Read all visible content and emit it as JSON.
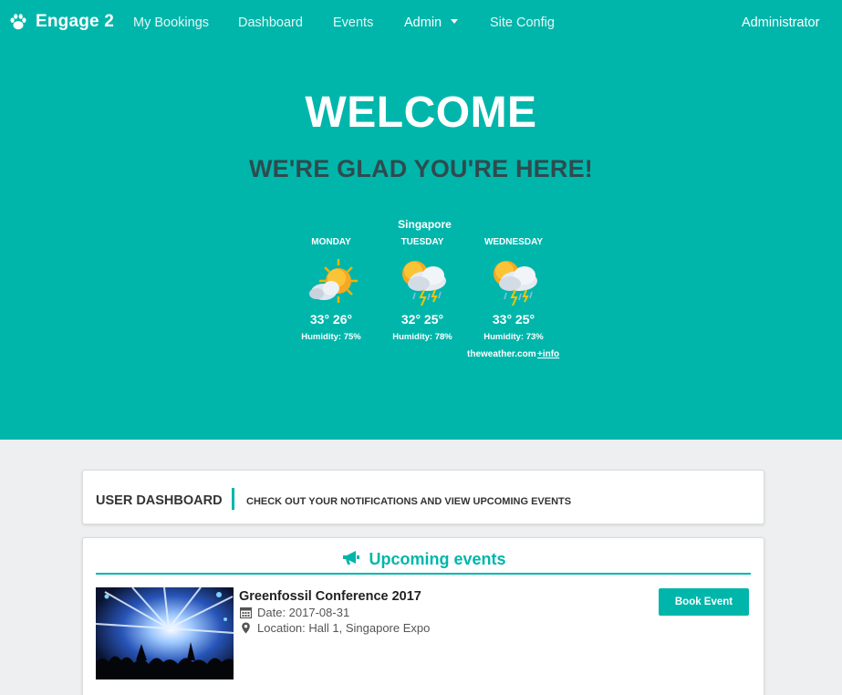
{
  "nav": {
    "brand": "Engage 2",
    "items": [
      {
        "label": "My Bookings"
      },
      {
        "label": "Dashboard"
      },
      {
        "label": "Events"
      },
      {
        "label": "Admin"
      },
      {
        "label": "Site Config"
      }
    ],
    "user": "Administrator"
  },
  "hero": {
    "title": "WELCOME",
    "subtitle": "WE'RE GLAD YOU'RE HERE!"
  },
  "weather": {
    "city": "Singapore",
    "days": [
      {
        "name": "MONDAY",
        "temp": "33° 26°",
        "humidity": "Humidity:  75%",
        "icon": "sun-cloud-icon"
      },
      {
        "name": "TUESDAY",
        "temp": "32° 25°",
        "humidity": "Humidity:  78%",
        "icon": "thunderstorm-icon"
      },
      {
        "name": "WEDNESDAY",
        "temp": "33° 25°",
        "humidity": "Humidity:  73%",
        "icon": "thunderstorm-icon"
      }
    ],
    "credit": "theweather.com",
    "more": "+info"
  },
  "dashboard": {
    "title": "USER DASHBOARD",
    "subtitle": "CHECK OUT YOUR NOTIFICATIONS AND VIEW UPCOMING EVENTS"
  },
  "events": {
    "header": "Upcoming events",
    "items": [
      {
        "title": "Greenfossil Conference 2017",
        "date": "Date: 2017-08-31",
        "location": "Location: Hall 1, Singapore Expo",
        "button": "Book Event"
      }
    ]
  },
  "colors": {
    "accent": "#00b6ab",
    "hero_subtitle": "#2f4b4f",
    "background": "#eeeff1"
  }
}
